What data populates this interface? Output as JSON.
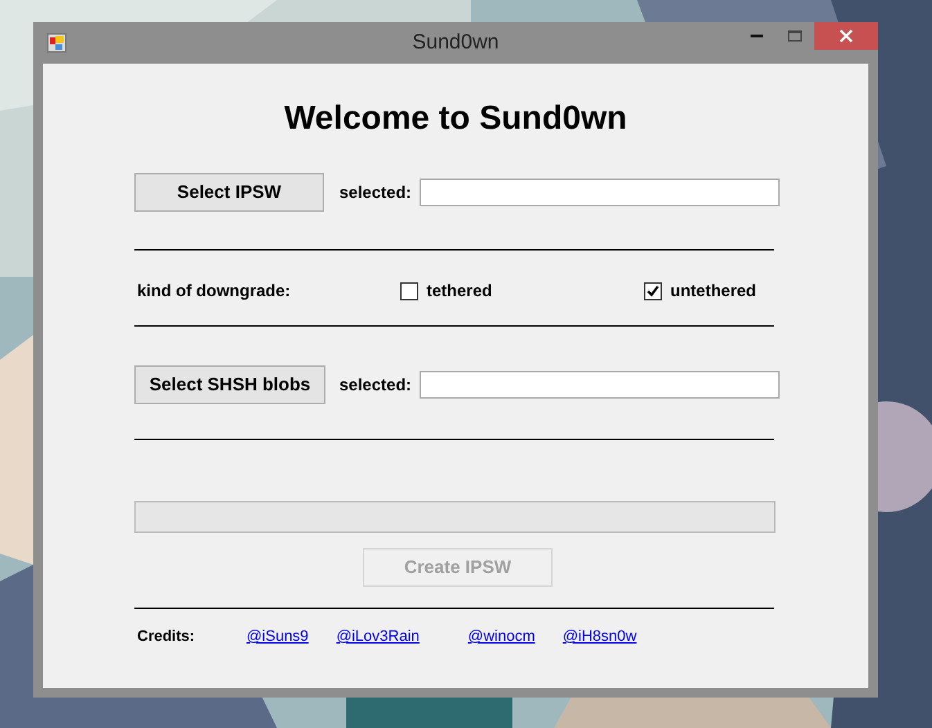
{
  "window": {
    "title": "Sund0wn"
  },
  "heading": "Welcome to Sund0wn",
  "ipsw": {
    "button": "Select IPSW",
    "label": "selected:"
  },
  "downgrade": {
    "label": "kind of downgrade:",
    "options": [
      {
        "label": "tethered",
        "checked": false
      },
      {
        "label": "untethered",
        "checked": true
      }
    ]
  },
  "shsh": {
    "button": "Select SHSH blobs",
    "label": "selected:"
  },
  "progress": {
    "level": 0
  },
  "create_button": {
    "label": "Create IPSW",
    "disabled": true
  },
  "credits": {
    "label": "Credits:",
    "links": [
      "@iSuns9",
      "@iLov3Rain",
      "@winocm",
      "@iH8sn0w"
    ]
  }
}
